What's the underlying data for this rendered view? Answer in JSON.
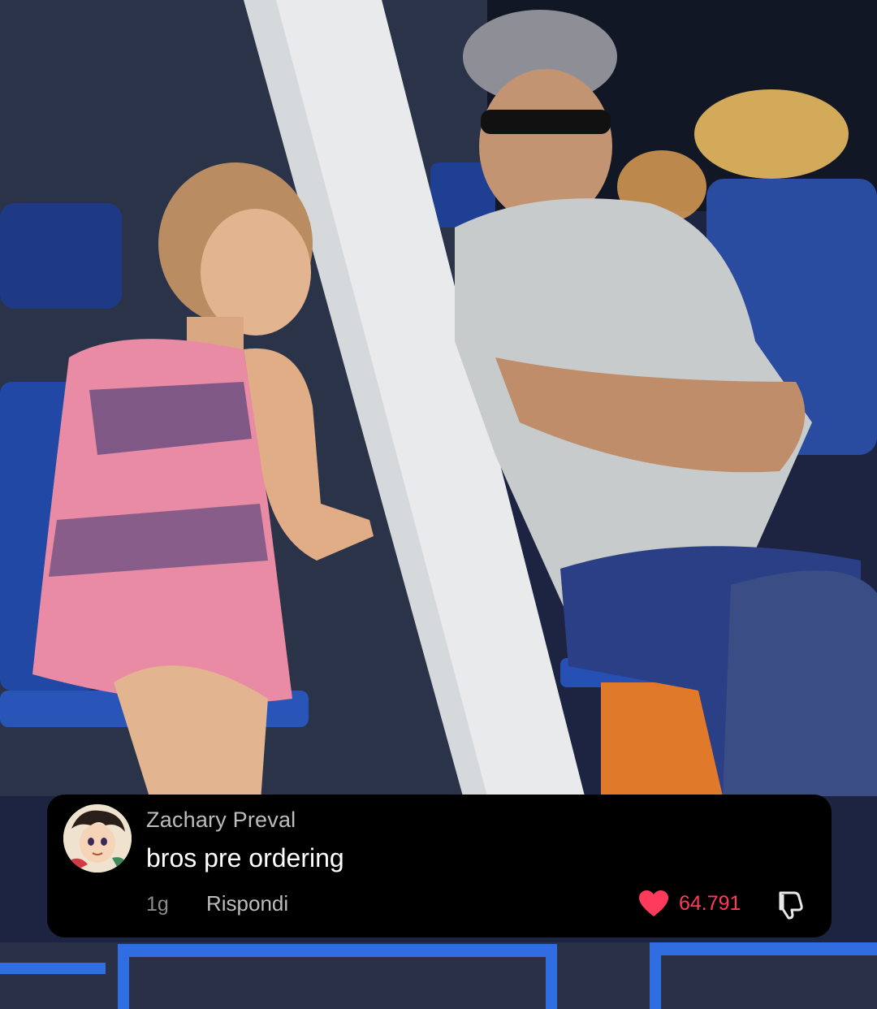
{
  "comment": {
    "username": "Zachary Preval",
    "text": "bros pre ordering",
    "time": "1g",
    "reply_label": "Rispondi",
    "likes": "64.791",
    "avatar": "anime-avatar",
    "heart_icon": "heart-icon",
    "dislike_icon": "thumbs-down-icon",
    "accent_color": "#ff3b5c"
  }
}
